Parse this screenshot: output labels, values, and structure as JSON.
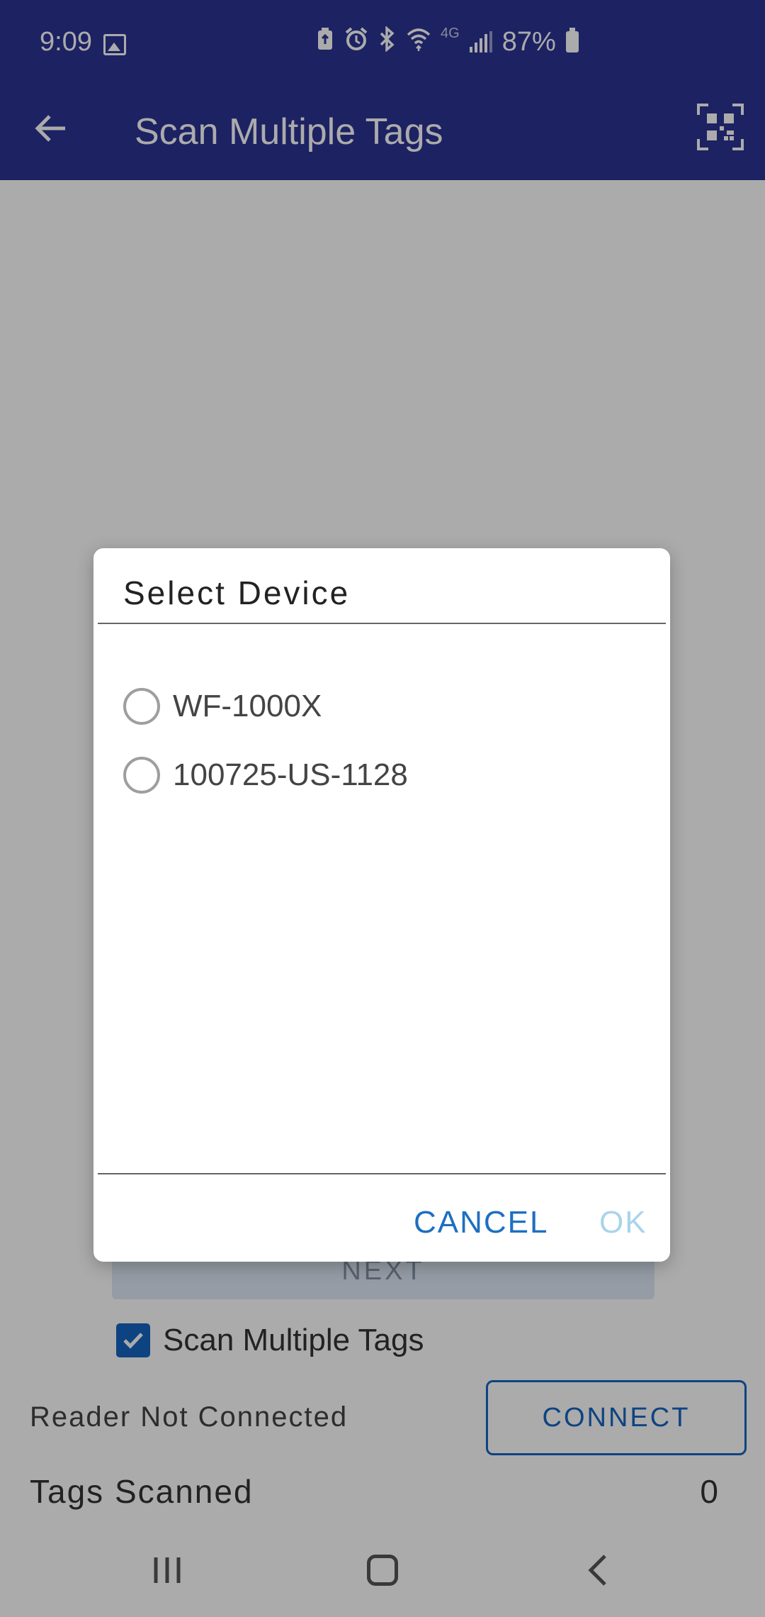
{
  "status_bar": {
    "time": "9:09",
    "network": "4G",
    "battery": "87%"
  },
  "app_bar": {
    "title": "Scan Multiple Tags"
  },
  "main": {
    "next_label": "NEXT",
    "scan_multiple_label": "Scan Multiple Tags",
    "scan_multiple_checked": true,
    "reader_status": "Reader Not Connected",
    "connect_label": "CONNECT",
    "tags_scanned_label": "Tags Scanned",
    "tags_scanned_count": "0"
  },
  "dialog": {
    "title": "Select Device",
    "devices": [
      {
        "label": "WF-1000X",
        "selected": false
      },
      {
        "label": "100725-US-1128",
        "selected": false
      }
    ],
    "cancel_label": "CANCEL",
    "ok_label": "OK"
  },
  "colors": {
    "app_bar": "#2c3494",
    "accent": "#1565c0",
    "ok_disabled": "#a9d4ea"
  },
  "icons": {
    "status": [
      "gallery-icon",
      "battery-saver-icon",
      "alarm-icon",
      "bluetooth-icon",
      "wifi-icon",
      "signal-icon",
      "battery-icon"
    ],
    "app_bar": [
      "back-arrow-icon",
      "qr-code-icon"
    ],
    "nav": [
      "recents-icon",
      "home-icon",
      "back-icon"
    ]
  }
}
